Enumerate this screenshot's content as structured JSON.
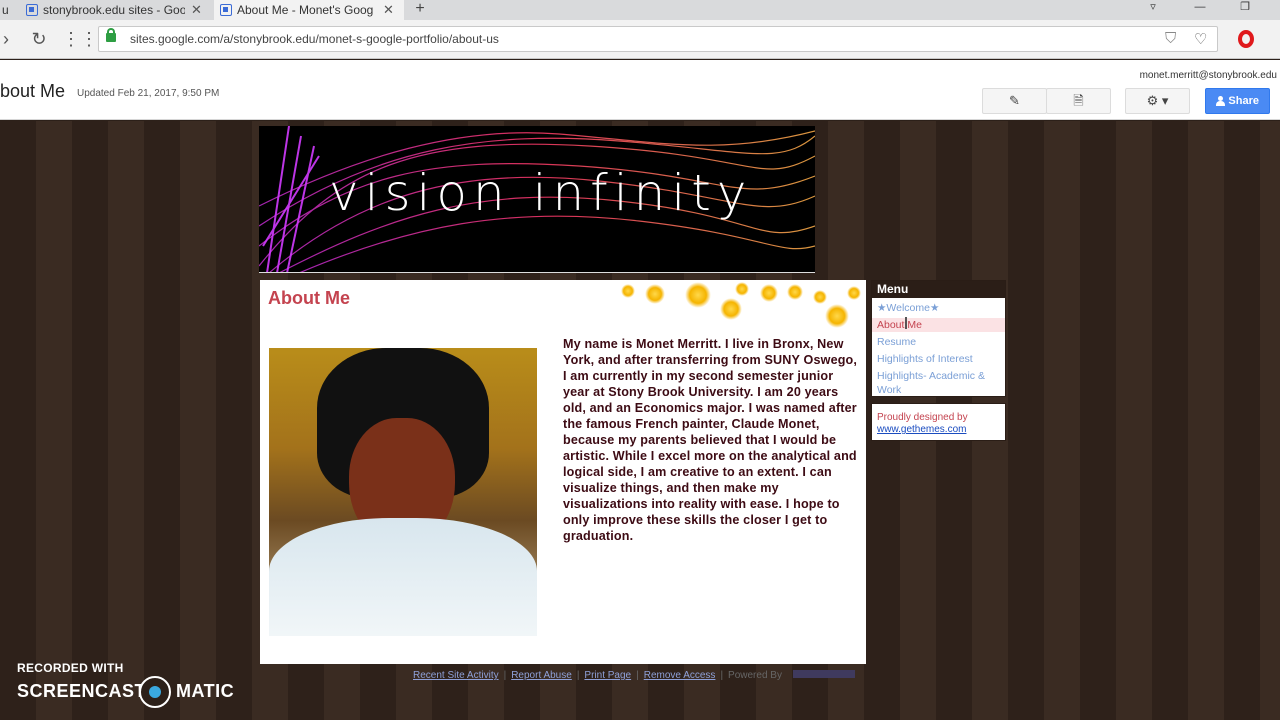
{
  "browser": {
    "tabs": [
      {
        "label": "stonybrook.edu sites - Goo",
        "active": false
      },
      {
        "label": "About Me - Monet's Goog",
        "active": true
      }
    ],
    "prev_tab_fragment": "u",
    "url": "sites.google.com/a/stonybrook.edu/monet-s-google-portfolio/about-us"
  },
  "sites_header": {
    "page_name": "bout Me",
    "updated": "Updated Feb 21, 2017, 9:50 PM",
    "account": "monet.merritt@stonybrook.edu",
    "share_label": "Share"
  },
  "banner": {
    "title": "vision  infinity"
  },
  "content": {
    "title": "About Me",
    "bio": "My name is Monet Merritt. I live in Bronx, New York, and after transferring from SUNY Oswego, I am currently in my second semester junior year at Stony Brook University. I am 20 years old, and an Economics major. I was named after the famous French painter, Claude Monet, because my parents believed that I would be artistic. While I excel more on the analytical and logical side, I am creative to an extent. I can visualize things, and then make my visualizations into reality with ease. I hope to only improve these skills the closer I get to graduation."
  },
  "menu": {
    "header": "Menu",
    "items": [
      {
        "label": "★Welcome★",
        "active": false
      },
      {
        "label": "About Me",
        "active": true
      },
      {
        "label": "Resume",
        "active": false
      },
      {
        "label": "Highlights of Interest",
        "active": false
      },
      {
        "label": "Highlights- Academic & Work",
        "active": false
      }
    ]
  },
  "designed_by": {
    "label": "Proudly designed by",
    "link": "www.gethemes.com"
  },
  "footer": {
    "links": [
      "Recent Site Activity",
      "Report Abuse",
      "Print Page",
      "Remove Access"
    ],
    "powered_by": "Powered By"
  },
  "watermark": {
    "top": "RECORDED WITH",
    "left": "SCREENCAST",
    "right": "MATIC"
  },
  "colors": {
    "accent": "#c4434f",
    "menu_link": "#7a9fd6",
    "share": "#4a8af4",
    "site_bg": "#2e211a"
  }
}
